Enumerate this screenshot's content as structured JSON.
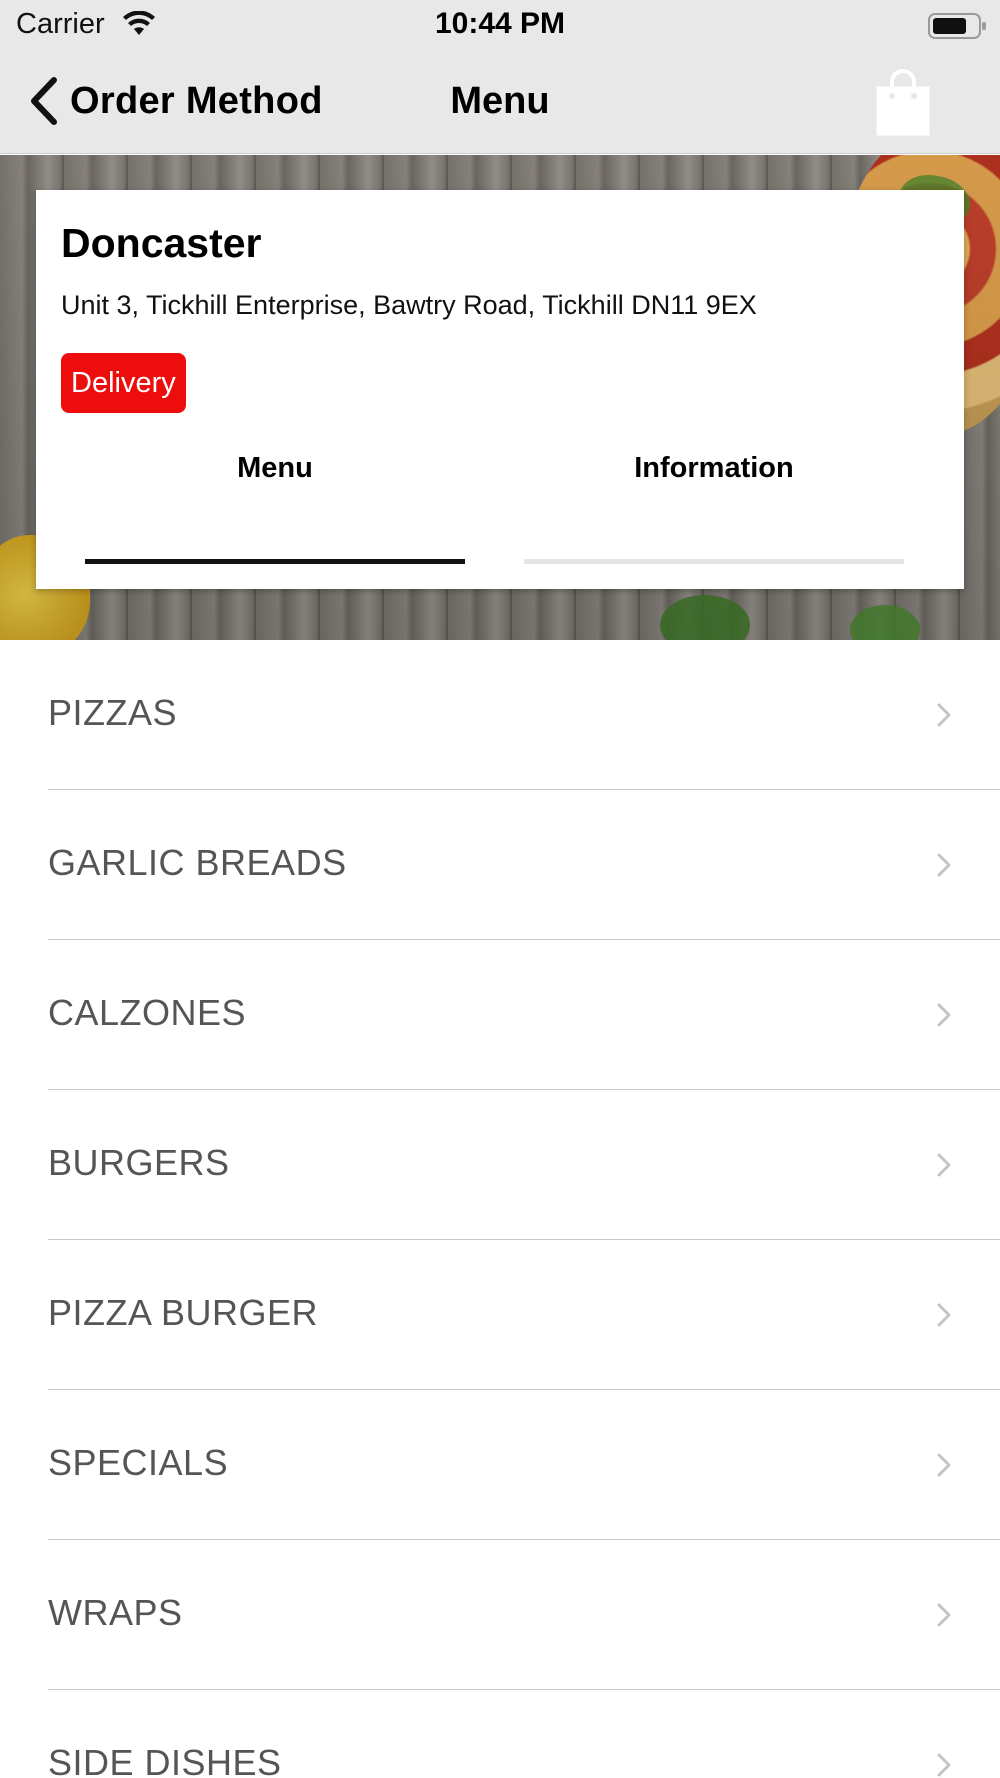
{
  "status_bar": {
    "carrier": "Carrier",
    "time": "10:44 PM"
  },
  "nav": {
    "back_label": "Order Method",
    "title": "Menu"
  },
  "store": {
    "name": "Doncaster",
    "address": "Unit 3, Tickhill Enterprise, Bawtry Road, Tickhill DN11 9EX",
    "badge": "Delivery",
    "badge_color": "#ee0d0d"
  },
  "tabs": [
    {
      "label": "Menu",
      "active": true
    },
    {
      "label": "Information",
      "active": false
    }
  ],
  "menu_items": [
    {
      "label": "PIZZAS"
    },
    {
      "label": "GARLIC BREADS"
    },
    {
      "label": "CALZONES"
    },
    {
      "label": "BURGERS"
    },
    {
      "label": "PIZZA BURGER"
    },
    {
      "label": "SPECIALS"
    },
    {
      "label": "WRAPS"
    },
    {
      "label": "SIDE DISHES"
    }
  ],
  "icons": {
    "back": "chevron-left-icon",
    "cart": "shopping-bag-icon",
    "row": "chevron-right-icon"
  }
}
